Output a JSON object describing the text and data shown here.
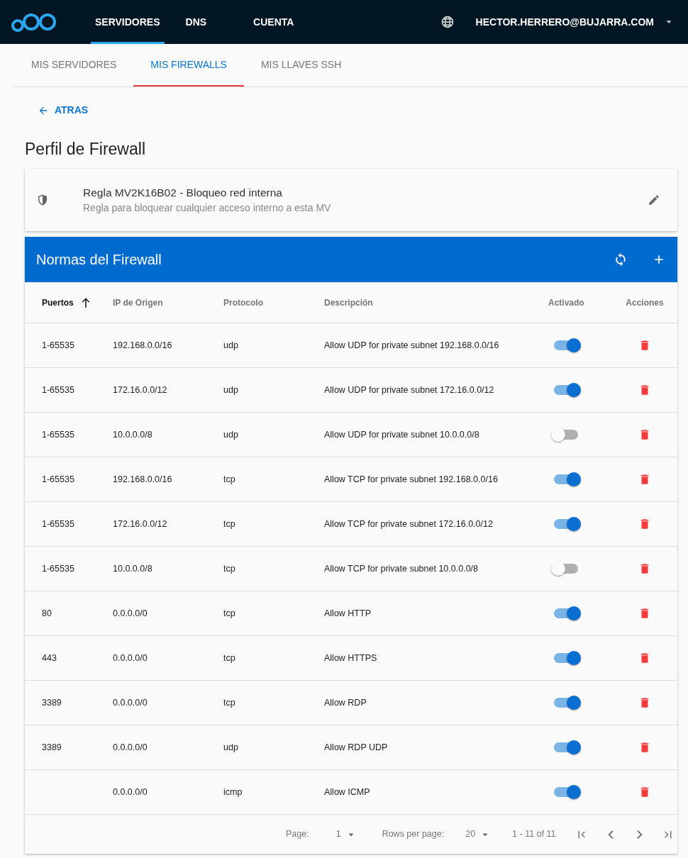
{
  "navbar": {
    "links": [
      {
        "label": "SERVIDORES",
        "selected": true
      },
      {
        "label": "DNS",
        "selected": false
      },
      {
        "label": "CUENTA",
        "selected": false
      }
    ],
    "user": "HECTOR.HERRERO@BUJARRA.COM"
  },
  "tabs": [
    {
      "label": "MIS SERVIDORES",
      "selected": false
    },
    {
      "label": "MIS FIREWALLS",
      "selected": true
    },
    {
      "label": "MIS LLAVES SSH",
      "selected": false
    }
  ],
  "back": "ATRAS",
  "page_title": "Perfil de Firewall",
  "profile": {
    "name": "Regla MV2K16B02 - Bloqueo red interna",
    "description": "Regla para bloquear cualquier acceso interno a esta MV"
  },
  "rules": {
    "title": "Normas del Firewall",
    "columns": [
      {
        "label": "Puertos",
        "sorted": true
      },
      {
        "label": "IP de Origen",
        "sorted": false
      },
      {
        "label": "Protocolo",
        "sorted": false
      },
      {
        "label": "Descripción",
        "sorted": false
      },
      {
        "label": "Activado",
        "sorted": false
      },
      {
        "label": "Acciones",
        "sorted": false
      }
    ],
    "rows": [
      {
        "ports": "1-65535",
        "source": "192.168.0.0/16",
        "protocol": "udp",
        "description": "Allow UDP for private subnet 192.168.0.0/16",
        "enabled": true
      },
      {
        "ports": "1-65535",
        "source": "172.16.0.0/12",
        "protocol": "udp",
        "description": "Allow UDP for private subnet 172.16.0.0/12",
        "enabled": true
      },
      {
        "ports": "1-65535",
        "source": "10.0.0.0/8",
        "protocol": "udp",
        "description": "Allow UDP for private subnet 10.0.0.0/8",
        "enabled": false
      },
      {
        "ports": "1-65535",
        "source": "192.168.0.0/16",
        "protocol": "tcp",
        "description": "Allow TCP for private subnet 192.168.0.0/16",
        "enabled": true
      },
      {
        "ports": "1-65535",
        "source": "172.16.0.0/12",
        "protocol": "tcp",
        "description": "Allow TCP for private subnet 172.16.0.0/12",
        "enabled": true
      },
      {
        "ports": "1-65535",
        "source": "10.0.0.0/8",
        "protocol": "tcp",
        "description": "Allow TCP for private subnet 10.0.0.0/8",
        "enabled": false
      },
      {
        "ports": "80",
        "source": "0.0.0.0/0",
        "protocol": "tcp",
        "description": "Allow HTTP",
        "enabled": true
      },
      {
        "ports": "443",
        "source": "0.0.0.0/0",
        "protocol": "tcp",
        "description": "Allow HTTPS",
        "enabled": true
      },
      {
        "ports": "3389",
        "source": "0.0.0.0/0",
        "protocol": "tcp",
        "description": "Allow RDP",
        "enabled": true
      },
      {
        "ports": "3389",
        "source": "0.0.0.0/0",
        "protocol": "udp",
        "description": "Allow RDP UDP",
        "enabled": true
      },
      {
        "source": "0.0.0.0/0",
        "protocol": "icmp",
        "description": "Allow ICMP",
        "enabled": true
      }
    ],
    "pagination": {
      "page_label": "Page:",
      "page": "1",
      "rows_label": "Rows per page:",
      "rows_per_page": "20",
      "range": "1 - 11 of 11"
    }
  }
}
